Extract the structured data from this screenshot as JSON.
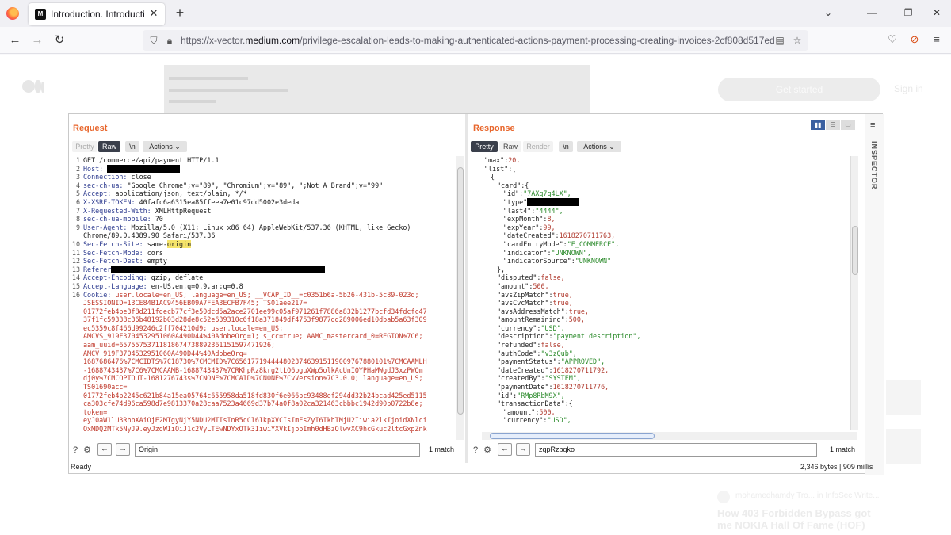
{
  "browser": {
    "tab_title": "Introduction. Introduction | by X-Vector",
    "tab_favicon": "M",
    "url_prefix": "https://x-vector.",
    "url_domain": "medium.com",
    "url_path": "/privilege-escalation-leads-to-making-authenticated-actions-payment-processing-creating-invoices-2cf808d517ed"
  },
  "page": {
    "get_started": "Get started",
    "sign_in": "Sign in",
    "related_author": "mohamedhamdy Tro... in InfoSec Write...",
    "related_title": "How 403 Forbidden Bypass got me NOKIA Hall Of Fame (HOF)"
  },
  "burp": {
    "request": {
      "title": "Request",
      "tabs": [
        "Pretty",
        "Raw",
        "\\n",
        "Actions"
      ],
      "search_value": "Origin",
      "match_text": "1 match",
      "status": "Ready",
      "lines": [
        {
          "n": "1",
          "key": "",
          "val": "GET /commerce/api/payment HTTP/1.1"
        },
        {
          "n": "2",
          "key": "Host: ",
          "val": "",
          "redact": 92
        },
        {
          "n": "3",
          "key": "Connection: ",
          "val": "close"
        },
        {
          "n": "4",
          "key": "sec-ch-ua: ",
          "val": "\"Google Chrome\";v=\"89\", \"Chromium\";v=\"89\", \";Not A Brand\";v=\"99\""
        },
        {
          "n": "5",
          "key": "Accept: ",
          "val": "application/json, text/plain, */*"
        },
        {
          "n": "6",
          "key": "X-XSRF-TOKEN: ",
          "val": "40fafc6a6315ea85ffeea7e01c97dd5002e3deda"
        },
        {
          "n": "7",
          "key": "X-Requested-With: ",
          "val": "XMLHttpRequest"
        },
        {
          "n": "8",
          "key": "sec-ch-ua-mobile: ",
          "val": "?0"
        },
        {
          "n": "9",
          "key": "User-Agent: ",
          "val": "Mozilla/5.0 (X11; Linux x86_64) AppleWebKit/537.36 (KHTML, like Gecko)"
        },
        {
          "n": "",
          "key": "",
          "val": "Chrome/89.0.4389.90 Safari/537.36"
        },
        {
          "n": "10",
          "key": "Sec-Fetch-Site: ",
          "val": "same-",
          "hl": "origin"
        },
        {
          "n": "11",
          "key": "Sec-Fetch-Mode: ",
          "val": "cors"
        },
        {
          "n": "12",
          "key": "Sec-Fetch-Dest: ",
          "val": "empty"
        },
        {
          "n": "13",
          "key": "Referer",
          "val": "",
          "redact": 270
        },
        {
          "n": "14",
          "key": "Accept-Encoding: ",
          "val": "gzip, deflate"
        },
        {
          "n": "15",
          "key": "Accept-Language: ",
          "val": "en-US,en;q=0.9,ar;q=0.8"
        },
        {
          "n": "16",
          "key": "Cookie: ",
          "val": "",
          "cookie": "user.locale=en_US; language=en_US; __VCAP_ID__=c0351b6a-5b26-431b-5c89-023d;"
        }
      ],
      "cookie_lines": [
        "JSESSIONID=13CE84B1AC9456EB09A7FEA3ECFB7F45; TS01aee217=",
        "01772feb4be3f8d211fdecb77cf3e50dcd5a2ace2701ee99c05af971261f7886a832b1277bcfd34fdcfc47",
        "37f1fc59338c36b48192b03d28de8c52e639310c6f18a371849df4753f9877dd289006ed10dbab5a63f309",
        "ec5359c8f466d99246c2ff704210d9; user.locale=en_US;",
        "AMCVS_919F3704532951060A490D44%40AdobeOrg=1; s_cc=true; AAMC_mastercard_0=REGION%7C6;",
        "aam_uuid=65755753711818674738892361151597471926;",
        "AMCV_919F3704532951060A490D44%40AdobeOrg=",
        "1687686476%7CMCIDTS%7C18730%7CMCMID%7C65617719444480237463915119009767880101%7CMCAAMLH",
        "-1688743437%7C6%7CMCAAMB-1688743437%7CRKhpRz8krg2tLO6pguXWp5olkAcUnIQYPHaMWgdJ3xzPWQm",
        "dj0y%7CMCOPTOUT-1681276743s%7CNONE%7CMCAID%7CNONE%7CvVersion%7C3.0.0; language=en_US;",
        "TS01690acc=",
        "01772feb4b2245c621b84a15ea05764c655958da518fd830f6e066bc93488ef294dd32b24bcad425ed5115",
        "ca303cfe74d96ca598d7e9813370a28caa7523a4669d37b74a0f8a02ca321463cbbbc1942d90b0722b8e;",
        "token=",
        "eyJ0aW1lU3RhbXAiOjE2MTgyNjY5NDU2MTIsInR5cCI6IkpXVCIsImFsZyI6IkhTMjU2Iiwia2lkIjoidXNlci",
        "OxMDQ2MTk5NyJ9.eyJzdWIiOiJ1c2VyLTEwNDYxOTk3IiwiYXVkIjpbImh0dHBzOlwvXC9hcGkuc2ltcGxpZnk"
      ]
    },
    "response": {
      "title": "Response",
      "tabs": [
        "Pretty",
        "Raw",
        "Render",
        "\\n",
        "Actions"
      ],
      "search_value": "zqpRzbqko",
      "match_text": "1 match",
      "status": "2,346 bytes | 909 millis",
      "lines": [
        {
          "indent": 2,
          "key": "\"max\":",
          "val": "20,",
          "type": "n"
        },
        {
          "indent": 2,
          "key": "\"list\":[",
          "val": "",
          "type": ""
        },
        {
          "indent": 3,
          "key": "{",
          "val": "",
          "type": ""
        },
        {
          "indent": 4,
          "key": "\"card\":{",
          "val": "",
          "type": ""
        },
        {
          "indent": 5,
          "key": "\"id\":",
          "val": "\"7AXq7q4LX\",",
          "type": "s"
        },
        {
          "indent": 5,
          "key": "\"type\"",
          "val": "",
          "type": "",
          "redact": 66
        },
        {
          "indent": 5,
          "key": "\"last4\":",
          "val": "\"4444\",",
          "type": "s"
        },
        {
          "indent": 5,
          "key": "\"expMonth\":",
          "val": "8,",
          "type": "n"
        },
        {
          "indent": 5,
          "key": "\"expYear\":",
          "val": "99,",
          "type": "n"
        },
        {
          "indent": 5,
          "key": "\"dateCreated\":",
          "val": "1618270711763,",
          "type": "n"
        },
        {
          "indent": 5,
          "key": "\"cardEntryMode\":",
          "val": "\"E_COMMERCE\",",
          "type": "s"
        },
        {
          "indent": 5,
          "key": "\"indicator\":",
          "val": "\"UNKNOWN\",",
          "type": "s"
        },
        {
          "indent": 5,
          "key": "\"indicatorSource\":",
          "val": "\"UNKNOWN\"",
          "type": "s"
        },
        {
          "indent": 4,
          "key": "},",
          "val": "",
          "type": ""
        },
        {
          "indent": 4,
          "key": "\"disputed\":",
          "val": "false,",
          "type": "n"
        },
        {
          "indent": 4,
          "key": "\"amount\":",
          "val": "500,",
          "type": "n"
        },
        {
          "indent": 4,
          "key": "\"avsZipMatch\":",
          "val": "true,",
          "type": "n"
        },
        {
          "indent": 4,
          "key": "\"avsCvcMatch\":",
          "val": "true,",
          "type": "n"
        },
        {
          "indent": 4,
          "key": "\"avsAddressMatch\":",
          "val": "true,",
          "type": "n"
        },
        {
          "indent": 4,
          "key": "\"amountRemaining\":",
          "val": "500,",
          "type": "n"
        },
        {
          "indent": 4,
          "key": "\"currency\":",
          "val": "\"USD\",",
          "type": "s"
        },
        {
          "indent": 4,
          "key": "\"description\":",
          "val": "\"payment description\",",
          "type": "s"
        },
        {
          "indent": 4,
          "key": "\"refunded\":",
          "val": "false,",
          "type": "n"
        },
        {
          "indent": 4,
          "key": "\"authCode\":",
          "val": "\"v3zQub\",",
          "type": "s"
        },
        {
          "indent": 4,
          "key": "\"paymentStatus\":",
          "val": "\"APPROVED\",",
          "type": "s"
        },
        {
          "indent": 4,
          "key": "\"dateCreated\":",
          "val": "1618270711792,",
          "type": "n"
        },
        {
          "indent": 4,
          "key": "\"createdBy\":",
          "val": "\"SYSTEM\",",
          "type": "s"
        },
        {
          "indent": 4,
          "key": "\"paymentDate\":",
          "val": "1618270711776,",
          "type": "n"
        },
        {
          "indent": 4,
          "key": "\"id\":",
          "val": "\"RMp8RbM9X\",",
          "type": "s"
        },
        {
          "indent": 4,
          "key": "\"transactionData\":{",
          "val": "",
          "type": ""
        },
        {
          "indent": 5,
          "key": "\"amount\":",
          "val": "500,",
          "type": "n"
        },
        {
          "indent": 5,
          "key": "\"currency\":",
          "val": "\"USD\",",
          "type": "s"
        }
      ]
    },
    "inspector_label": "INSPECTOR"
  },
  "colors": {
    "accent": "#e8662c",
    "key_blue": "#2d3b8f",
    "cookie_red": "#c0392b",
    "json_green": "#2a8a2a"
  }
}
